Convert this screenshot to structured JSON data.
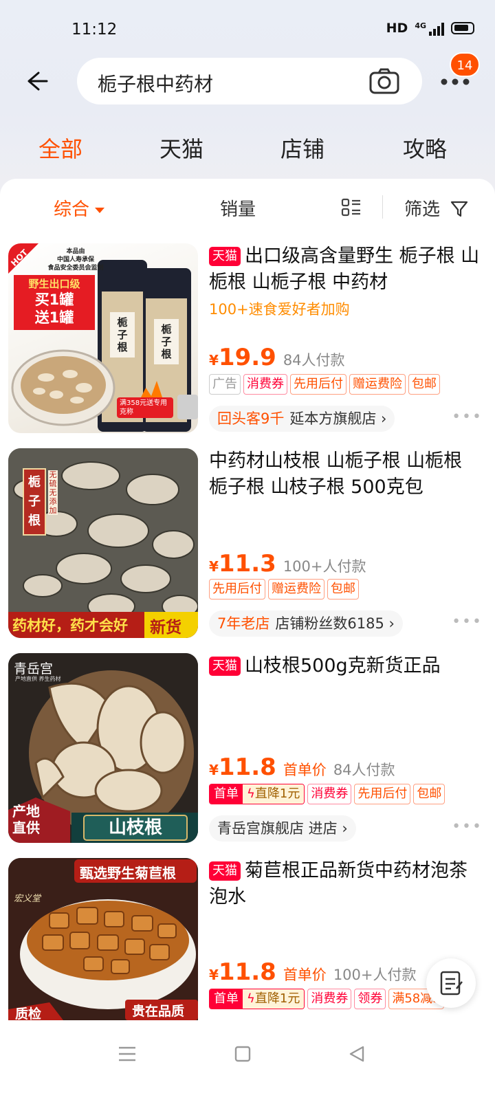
{
  "status": {
    "time": "11:12",
    "network": "HD",
    "signal": "4G"
  },
  "search": {
    "query": "栀子根中药材"
  },
  "cart_badge": "14",
  "tabs": [
    "全部",
    "天猫",
    "店铺",
    "攻略"
  ],
  "sort": {
    "comprehensive": "综合",
    "sales": "销量",
    "filter": "筛选"
  },
  "tmall_label": "天猫",
  "items": [
    {
      "tmall": true,
      "title": "出口级高含量野生 栀子根 山栀根 山栀子根 中药材",
      "subtitle": "100+速食爱好者加购",
      "price": "19.9",
      "sales": "84人付款",
      "tags": [
        "广告",
        "消费券",
        "先用后付",
        "赠运费险",
        "包邮"
      ],
      "shop_highlight": "回头客9千",
      "shop": "延本方旗舰店",
      "thumb": {
        "lines": [
          "本品由",
          "中国人寿承保",
          "食品安全委员会监制"
        ],
        "promo": [
          "野生出口级",
          "买1罐",
          "送1罐"
        ],
        "jar": "栀子根",
        "badge": "HOT",
        "bonus": "满358元送专用克称"
      }
    },
    {
      "tmall": false,
      "title": "中药材山枝根 山栀子根 山栀根 栀子根 山枝子根 500克包",
      "price": "11.3",
      "sales": "100+人付款",
      "tags": [
        "先用后付",
        "赠运费险",
        "包邮"
      ],
      "shop_highlight": "7年老店",
      "shop": "店铺粉丝数6185",
      "thumb": {
        "label": "栀子根",
        "sub": "无硫无添加",
        "banner": "药材好，药才会好",
        "new": "新货"
      }
    },
    {
      "tmall": true,
      "title": "山枝根500g克新货正品",
      "price": "11.8",
      "first_price": "首单价",
      "sales": "84人付款",
      "coupon": {
        "left": "首单",
        "right": "直降1元"
      },
      "tags": [
        "消费券",
        "先用后付",
        "包邮"
      ],
      "shop": "青岳宫旗舰店 进店",
      "thumb": {
        "brand": "青岳宫",
        "sub": "产地直供 养生药材",
        "origin": [
          "产地",
          "直供"
        ],
        "name": "山枝根"
      }
    },
    {
      "tmall": true,
      "title": "菊苣根正品新货中药材泡茶泡水",
      "price": "11.8",
      "first_price": "首单价",
      "sales": "100+人付款",
      "coupon": {
        "left": "首单",
        "right": "直降1元"
      },
      "tags": [
        "消费券",
        "领券",
        "满58减3"
      ],
      "thumb": {
        "banner": "甄选野生菊苣根",
        "brand": "宏义堂",
        "quality": "质检",
        "slogan": "贵在品质"
      }
    }
  ],
  "colors": {
    "accent": "#ff5000",
    "tmall": "#ff0036"
  }
}
